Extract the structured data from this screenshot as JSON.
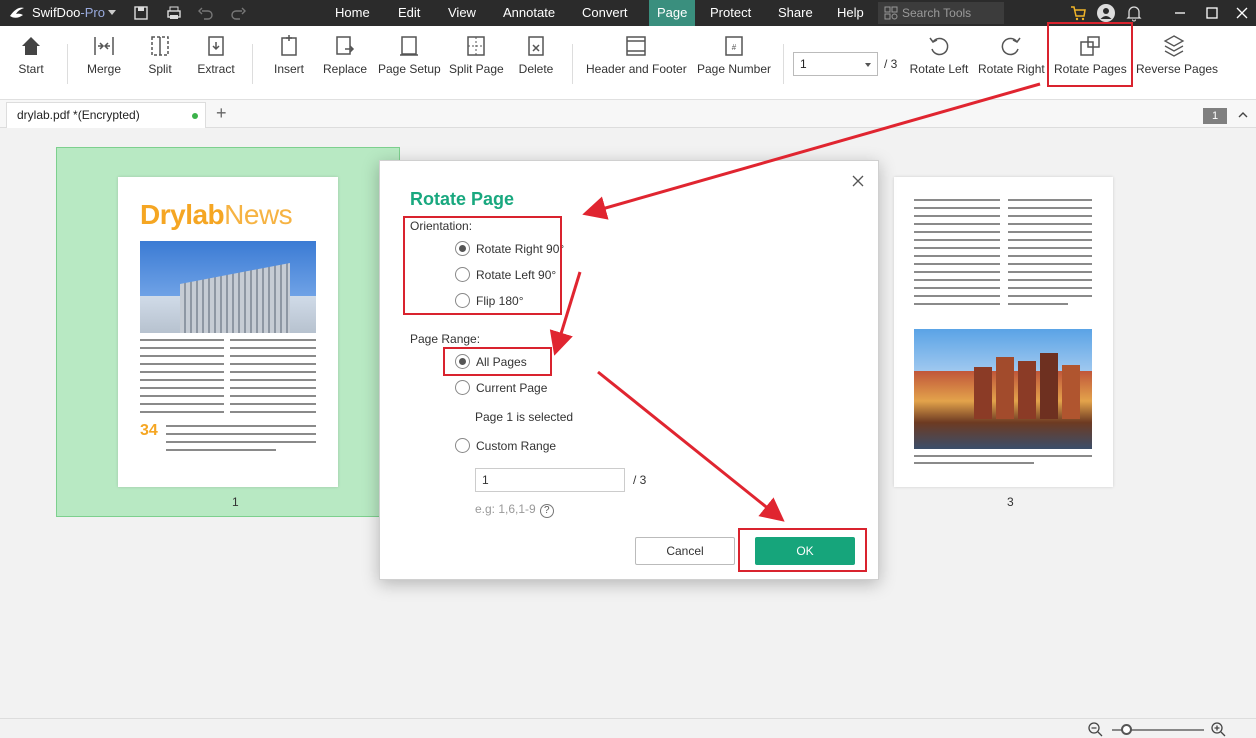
{
  "app": {
    "name": "SwifDoo",
    "edition": "-Pro"
  },
  "menu": [
    "Home",
    "Edit",
    "View",
    "Annotate",
    "Convert",
    "Page",
    "Protect",
    "Share",
    "Help"
  ],
  "menu_active": "Page",
  "search": {
    "placeholder": "Search Tools"
  },
  "toolbar": {
    "start": "Start",
    "merge": "Merge",
    "split": "Split",
    "extract": "Extract",
    "insert": "Insert",
    "replace": "Replace",
    "page_setup": "Page Setup",
    "split_page": "Split Page",
    "delete": "Delete",
    "header_footer": "Header and Footer",
    "page_number": "Page Number",
    "current_page": "1",
    "total_pages": "/ 3",
    "rotate_left": "Rotate Left",
    "rotate_right": "Rotate Right",
    "rotate_pages": "Rotate Pages",
    "reverse_pages": "Reverse Pages"
  },
  "tab": {
    "title": "drylab.pdf *(Encrypted)",
    "new_tab": "+",
    "badge": "1"
  },
  "pages": {
    "page1_label": "1",
    "page3_label": "3",
    "page1_masthead_a": "Drylab",
    "page1_masthead_b": "News",
    "page1_big_number": "34"
  },
  "dialog": {
    "title": "Rotate Page",
    "orientation_label": "Orientation:",
    "orientation_options": [
      "Rotate Right 90°",
      "Rotate Left 90°",
      "Flip 180°"
    ],
    "orientation_selected": 0,
    "range_label": "Page Range:",
    "range_options": [
      "All Pages",
      "Current Page",
      "Custom Range"
    ],
    "range_selected": 0,
    "selected_note": "Page 1 is selected",
    "custom_value": "1",
    "custom_total": "/ 3",
    "hint": "e.g: 1,6,1-9",
    "hint_icon": "?",
    "cancel": "Cancel",
    "ok": "OK"
  },
  "colors": {
    "accent": "#16a57b",
    "highlight": "#d9232e",
    "selection": "#b8e9c3"
  }
}
